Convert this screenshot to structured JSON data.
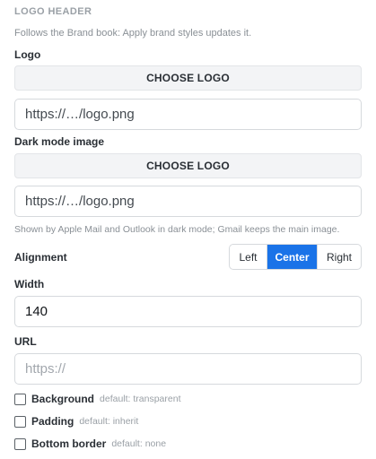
{
  "section": {
    "title": "LOGO HEADER",
    "hint": "Follows the Brand book: Apply brand styles updates it."
  },
  "logo": {
    "label": "Logo",
    "button": "CHOOSE LOGO",
    "url_value": "https://…/logo.png"
  },
  "dark_mode": {
    "label": "Dark mode image",
    "button": "CHOOSE LOGO",
    "url_value": "https://…/logo.png",
    "note": "Shown by Apple Mail and Outlook in dark mode; Gmail keeps the main image."
  },
  "alignment": {
    "label": "Alignment",
    "options": [
      "Left",
      "Center",
      "Right"
    ],
    "selected": "Center"
  },
  "width": {
    "label": "Width",
    "value": "140"
  },
  "url": {
    "label": "URL",
    "placeholder": "https://"
  },
  "options": [
    {
      "label": "Background",
      "default": "default: transparent",
      "checked": false
    },
    {
      "label": "Padding",
      "default": "default: inherit",
      "checked": false
    },
    {
      "label": "Bottom border",
      "default": "default: none",
      "checked": false
    }
  ],
  "colors": {
    "accent": "#1a73e8",
    "muted_text": "#9aa0a6",
    "button_bg": "#f3f4f6"
  }
}
